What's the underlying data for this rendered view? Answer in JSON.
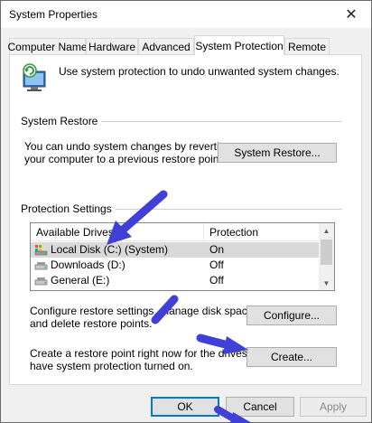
{
  "window": {
    "title": "System Properties"
  },
  "tabs": [
    {
      "label": "Computer Name"
    },
    {
      "label": "Hardware"
    },
    {
      "label": "Advanced"
    },
    {
      "label": "System Protection",
      "active": true
    },
    {
      "label": "Remote"
    }
  ],
  "intro": {
    "text": "Use system protection to undo unwanted system changes."
  },
  "restore": {
    "group_label": "System Restore",
    "description": [
      "You can undo system changes by reverting",
      "your computer to a previous restore point."
    ],
    "button": "System Restore..."
  },
  "protection": {
    "group_label": "Protection Settings",
    "columns": [
      "Available Drives",
      "Protection"
    ],
    "drives": [
      {
        "name": "Local Disk (C:) (System)",
        "protection": "On",
        "selected": true,
        "icon": "system-drive-icon"
      },
      {
        "name": "Downloads (D:)",
        "protection": "Off",
        "icon": "drive-icon"
      },
      {
        "name": "General (E:)",
        "protection": "Off",
        "icon": "drive-icon"
      }
    ],
    "configure_text": [
      "Configure restore settings, manage disk space,",
      "and delete restore points."
    ],
    "configure_button": "Configure...",
    "create_text": [
      "Create a restore point right now for the drives that",
      "have system protection turned on."
    ],
    "create_button": "Create..."
  },
  "footer": {
    "ok": "OK",
    "cancel": "Cancel",
    "apply": "Apply"
  },
  "colors": {
    "arrow": "#4040d8",
    "accent": "#0078d7"
  }
}
